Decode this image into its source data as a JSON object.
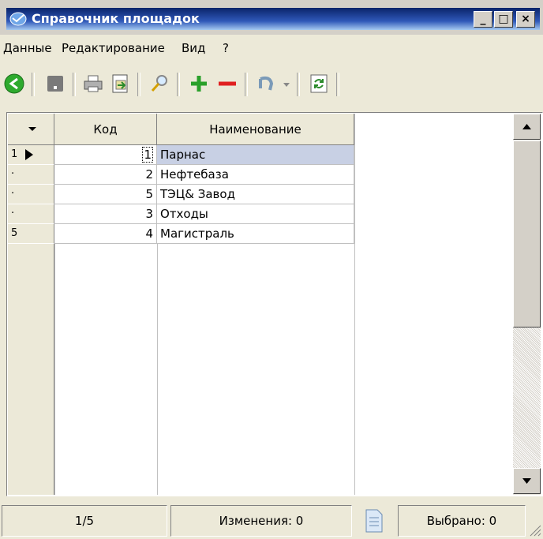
{
  "window": {
    "title": "Справочник площадок"
  },
  "menu": [
    "Данные",
    "Редактирование",
    "Вид",
    "?"
  ],
  "toolbar_icons": [
    "back-icon",
    "post-icon",
    "print-icon",
    "export-icon",
    "search-icon",
    "add-icon",
    "delete-icon",
    "undo-icon",
    "undo-dropdown-icon",
    "refresh-icon"
  ],
  "grid": {
    "columns": [
      "Код",
      "Наименование"
    ],
    "rows": [
      {
        "indicator": "1",
        "code": "1",
        "name": "Парнас",
        "current": true
      },
      {
        "indicator": "·",
        "code": "2",
        "name": "Нефтебаза"
      },
      {
        "indicator": "·",
        "code": "5",
        "name": "ТЭЦ& Завод"
      },
      {
        "indicator": "·",
        "code": "3",
        "name": "Отходы"
      },
      {
        "indicator": "5",
        "code": "4",
        "name": "Магистраль"
      }
    ]
  },
  "status": {
    "position": "1/5",
    "changes": "Изменения: 0",
    "selected": "Выбрано: 0"
  },
  "colors": {
    "selection": "#c8d0e4",
    "title_start": "#0a246a",
    "title_end": "#a6caf0"
  }
}
